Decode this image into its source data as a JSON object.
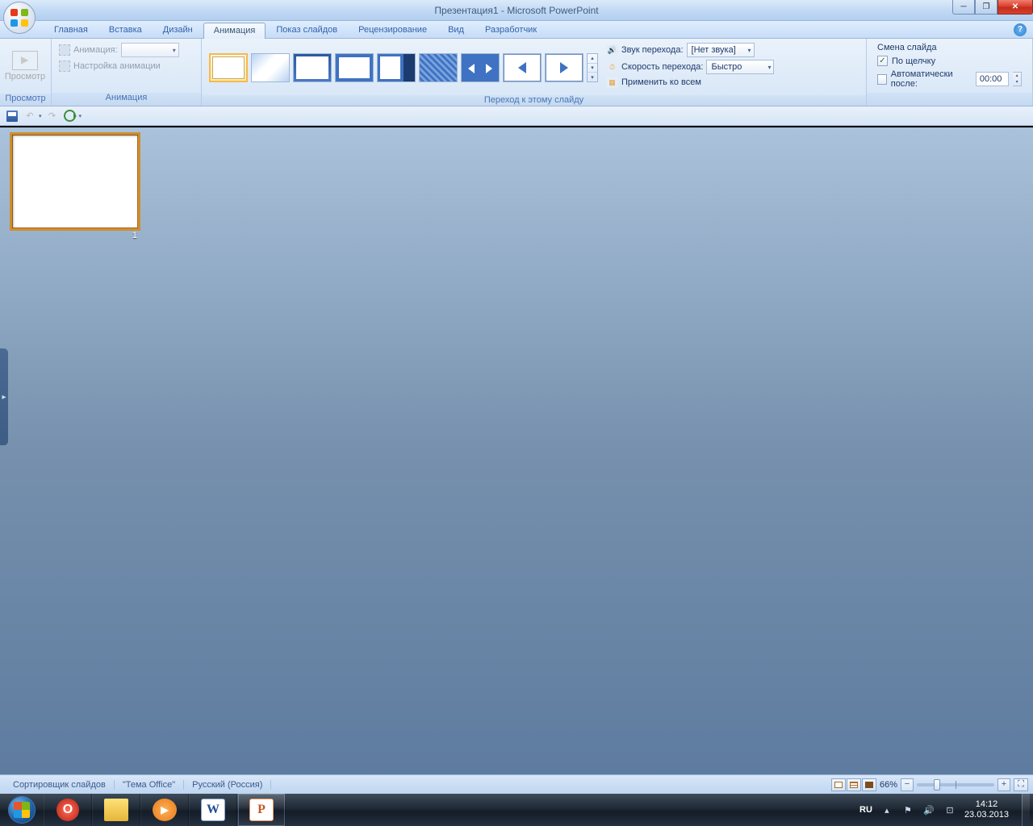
{
  "window": {
    "title": "Презентация1 - Microsoft PowerPoint"
  },
  "tabs": {
    "home": "Главная",
    "insert": "Вставка",
    "design": "Дизайн",
    "animation": "Анимация",
    "slideshow": "Показ слайдов",
    "review": "Рецензирование",
    "view": "Вид",
    "developer": "Разработчик"
  },
  "ribbon": {
    "preview_btn": "Просмотр",
    "group_preview": "Просмотр",
    "anim_label": "Анимация:",
    "anim_settings": "Настройка анимации",
    "group_animation": "Анимация",
    "sound_label": "Звук перехода:",
    "sound_val": "[Нет звука]",
    "speed_label": "Скорость перехода:",
    "speed_val": "Быстро",
    "apply_all": "Применить ко всем",
    "group_transition": "Переход к этому слайду",
    "advance_title": "Смена слайда",
    "on_click": "По щелчку",
    "auto_after": "Автоматически после:",
    "time_val": "00:00"
  },
  "slide": {
    "number": "1"
  },
  "status": {
    "sorter": "Сортировщик слайдов",
    "theme": "\"Тема Office\"",
    "lang": "Русский (Россия)",
    "zoom": "66%"
  },
  "taskbar": {
    "lang": "RU",
    "time": "14:12",
    "date": "23.03.2013"
  }
}
